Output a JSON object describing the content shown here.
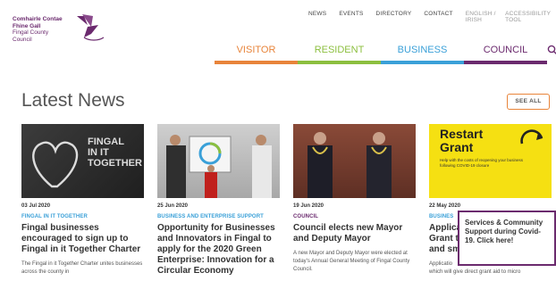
{
  "logo": {
    "irish_line1": "Comhairle Contae",
    "irish_line2": "Fhine Gall",
    "english_line1": "Fingal County",
    "english_line2": "Council"
  },
  "topnav": {
    "news": "NEWS",
    "events": "EVENTS",
    "directory": "DIRECTORY",
    "contact": "CONTACT",
    "language": "ENGLISH / IRISH",
    "accessibility": "ACCESSIBILITY TOOL"
  },
  "mainnav": {
    "visitor": "VISITOR",
    "resident": "RESIDENT",
    "business": "BUSINESS",
    "council": "COUNCIL"
  },
  "section": {
    "title": "Latest News",
    "see_all": "SEE ALL"
  },
  "cards": [
    {
      "image_text_line1": "FINGAL",
      "image_text_line2": "IN IT",
      "image_text_line3": "TOGETHER",
      "date": "03 Jul 2020",
      "category": "FINGAL IN IT TOGETHER",
      "title": "Fingal businesses encouraged to sign up to Fingal in it Together Charter",
      "desc": "The Fingal in it Together Charter unites businesses across the county in"
    },
    {
      "date": "25 Jun 2020",
      "category": "BUSINESS AND ENTERPRISE SUPPORT",
      "title": "Opportunity for Businesses and Innovators in Fingal to apply for the 2020 Green Enterprise: Innovation for a Circular Economy",
      "desc": ""
    },
    {
      "date": "19 Jun 2020",
      "category": "COUNCIL",
      "title": "Council elects new Mayor and Deputy Mayor",
      "desc": "A new Mayor and Deputy Mayor were elected at today's Annual General Meeting of Fingal County Council."
    },
    {
      "image_heading_line1": "Restart",
      "image_heading_line2": "Grant",
      "image_sub": "Help with the costs of reopening your business following COVID-19 closure",
      "date": "22 May 2020",
      "category": "BUSINES",
      "title_line1": "Applica",
      "title_line2": "Grant t",
      "title_line3": "and sm",
      "desc_line1": "Applicatio",
      "desc_line2": "which will give direct grant aid to micro"
    }
  ],
  "popup": {
    "text": "Services & Community Support during Covid-19. Click here!"
  },
  "colors": {
    "visitor": "#e8843a",
    "resident": "#8cbf3f",
    "business": "#3aa0d8",
    "council": "#6b2a6e"
  }
}
